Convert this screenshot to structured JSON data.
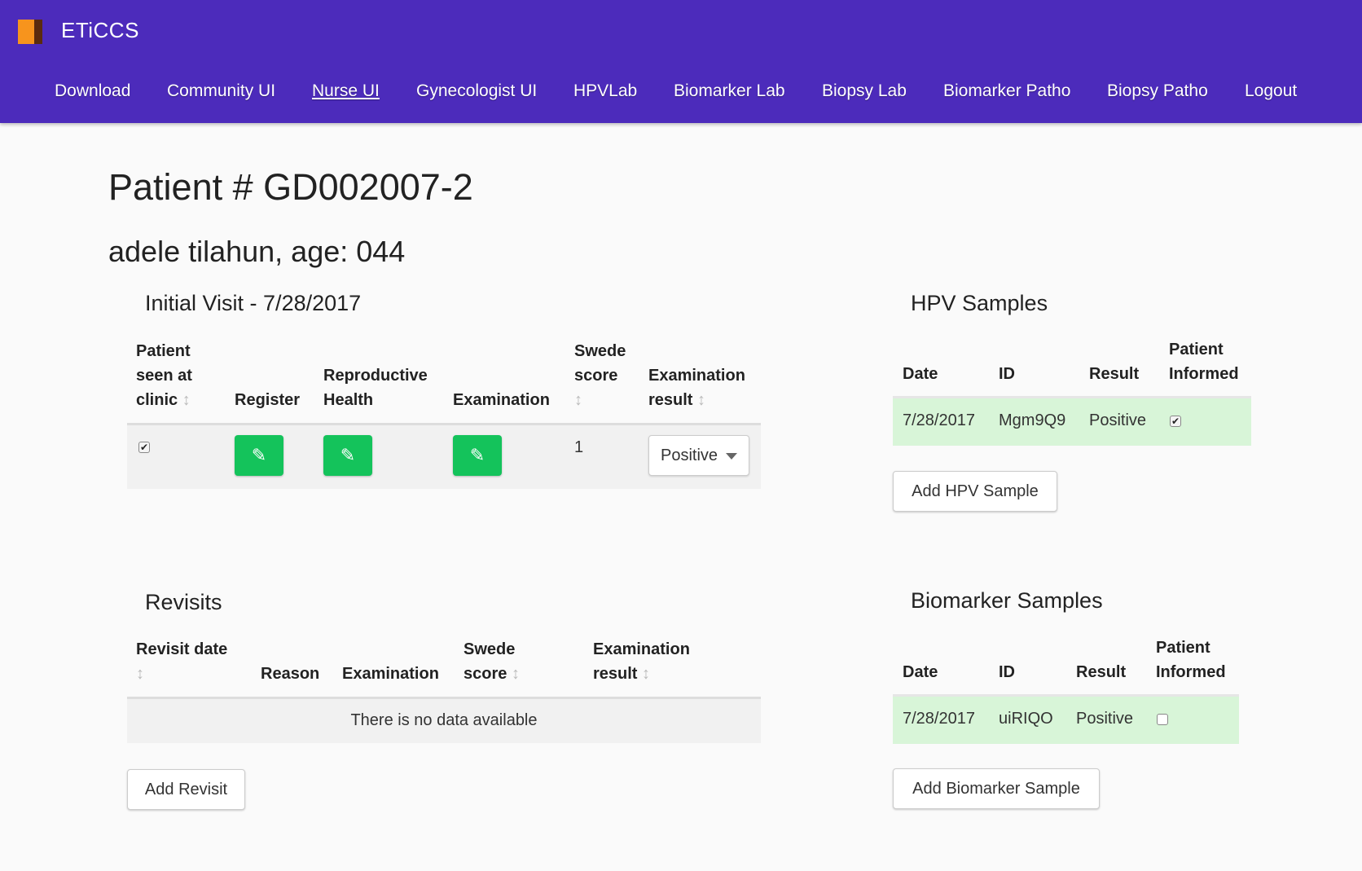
{
  "app": {
    "brand": "ETiCCS"
  },
  "nav": {
    "items": [
      {
        "label": "Download"
      },
      {
        "label": "Community UI"
      },
      {
        "label": "Nurse UI"
      },
      {
        "label": "Gynecologist UI"
      },
      {
        "label": "HPVLab"
      },
      {
        "label": "Biomarker Lab"
      },
      {
        "label": "Biopsy Lab"
      },
      {
        "label": "Biomarker Patho"
      },
      {
        "label": "Biopsy Patho"
      },
      {
        "label": "Logout"
      }
    ],
    "active": "Nurse UI"
  },
  "patient": {
    "title": "Patient # GD002007-2",
    "subtitle": "adele tilahun, age: 044"
  },
  "initial_visit": {
    "title": "Initial Visit - 7/28/2017",
    "headers": {
      "seen": [
        "Patient",
        "seen at",
        "clinic"
      ],
      "register": "Register",
      "repro": [
        "Reproductive",
        "Health"
      ],
      "exam": "Examination",
      "swede": [
        "Swede",
        "score"
      ],
      "result": [
        "Examination",
        "result"
      ]
    },
    "row": {
      "seen_checked": true,
      "swede_score": "1",
      "exam_result": "Positive"
    },
    "colors": {
      "row_bg": "#f1f1f1",
      "edit_button": "#14c35b"
    }
  },
  "revisits": {
    "title": "Revisits",
    "headers": {
      "date": [
        "Revisit date"
      ],
      "reason": "Reason",
      "exam": "Examination",
      "swede": [
        "Swede",
        "score"
      ],
      "result": [
        "Examination",
        "result"
      ]
    },
    "empty_message": "There is no data available",
    "add_button": "Add Revisit"
  },
  "hpv_samples": {
    "title": "HPV Samples",
    "headers": {
      "date": "Date",
      "id": "ID",
      "result": "Result",
      "informed": [
        "Patient",
        "Informed"
      ]
    },
    "rows": [
      {
        "date": "7/28/2017",
        "id": "Mgm9Q9",
        "result": "Positive",
        "informed": true
      }
    ],
    "add_button": "Add HPV Sample",
    "colors": {
      "row_bg": "#d8f5d8"
    }
  },
  "biomarker_samples": {
    "title": "Biomarker Samples",
    "headers": {
      "date": "Date",
      "id": "ID",
      "result": "Result",
      "informed": [
        "Patient",
        "Informed"
      ]
    },
    "rows": [
      {
        "date": "7/28/2017",
        "id": "uiRIQO",
        "result": "Positive",
        "informed": false
      }
    ],
    "add_button": "Add Biomarker Sample"
  },
  "icons": {
    "sort": "sort-icon",
    "edit": "pencil-icon",
    "caret": "caret-down-icon"
  },
  "colors": {
    "navbar": "#4c2bbb",
    "logo_orange": "#f7941d",
    "logo_brown": "#5a2b0e"
  }
}
